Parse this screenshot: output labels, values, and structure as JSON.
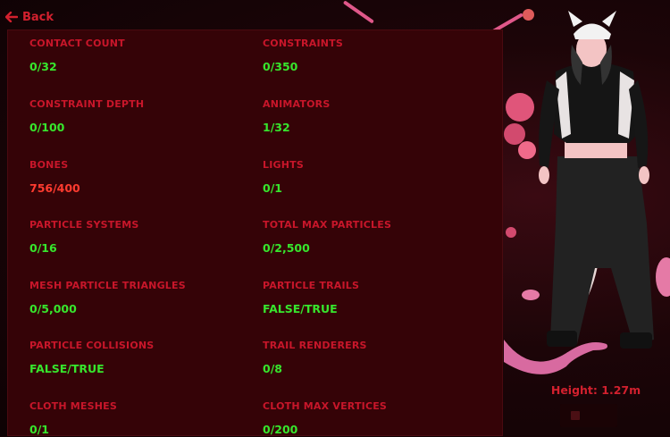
{
  "nav": {
    "back_label": "Back"
  },
  "stats": [
    {
      "label": "CONTACT COUNT",
      "value": "0/32",
      "status": "ok"
    },
    {
      "label": "CONSTRAINTS",
      "value": "0/350",
      "status": "ok"
    },
    {
      "label": "CONSTRAINT DEPTH",
      "value": "0/100",
      "status": "ok"
    },
    {
      "label": "ANIMATORS",
      "value": "1/32",
      "status": "ok"
    },
    {
      "label": "BONES",
      "value": "756/400",
      "status": "bad"
    },
    {
      "label": "LIGHTS",
      "value": "0/1",
      "status": "ok"
    },
    {
      "label": "PARTICLE SYSTEMS",
      "value": "0/16",
      "status": "ok"
    },
    {
      "label": "TOTAL MAX PARTICLES",
      "value": "0/2,500",
      "status": "ok"
    },
    {
      "label": "MESH PARTICLE TRIANGLES",
      "value": "0/5,000",
      "status": "ok"
    },
    {
      "label": "PARTICLE TRAILS",
      "value": "FALSE/TRUE",
      "status": "ok"
    },
    {
      "label": "PARTICLE COLLISIONS",
      "value": "FALSE/TRUE",
      "status": "ok"
    },
    {
      "label": "TRAIL RENDERERS",
      "value": "0/8",
      "status": "ok"
    },
    {
      "label": "CLOTH MESHES",
      "value": "0/1",
      "status": "ok"
    },
    {
      "label": "CLOTH MAX VERTICES",
      "value": "0/200",
      "status": "ok"
    }
  ],
  "avatar_preview": {
    "height_label": "Height: 1.27m"
  },
  "colors": {
    "label_red": "#c8162a",
    "value_green": "#37e62d",
    "value_over_limit": "#ff3b2f",
    "panel_bg": "#350307"
  }
}
